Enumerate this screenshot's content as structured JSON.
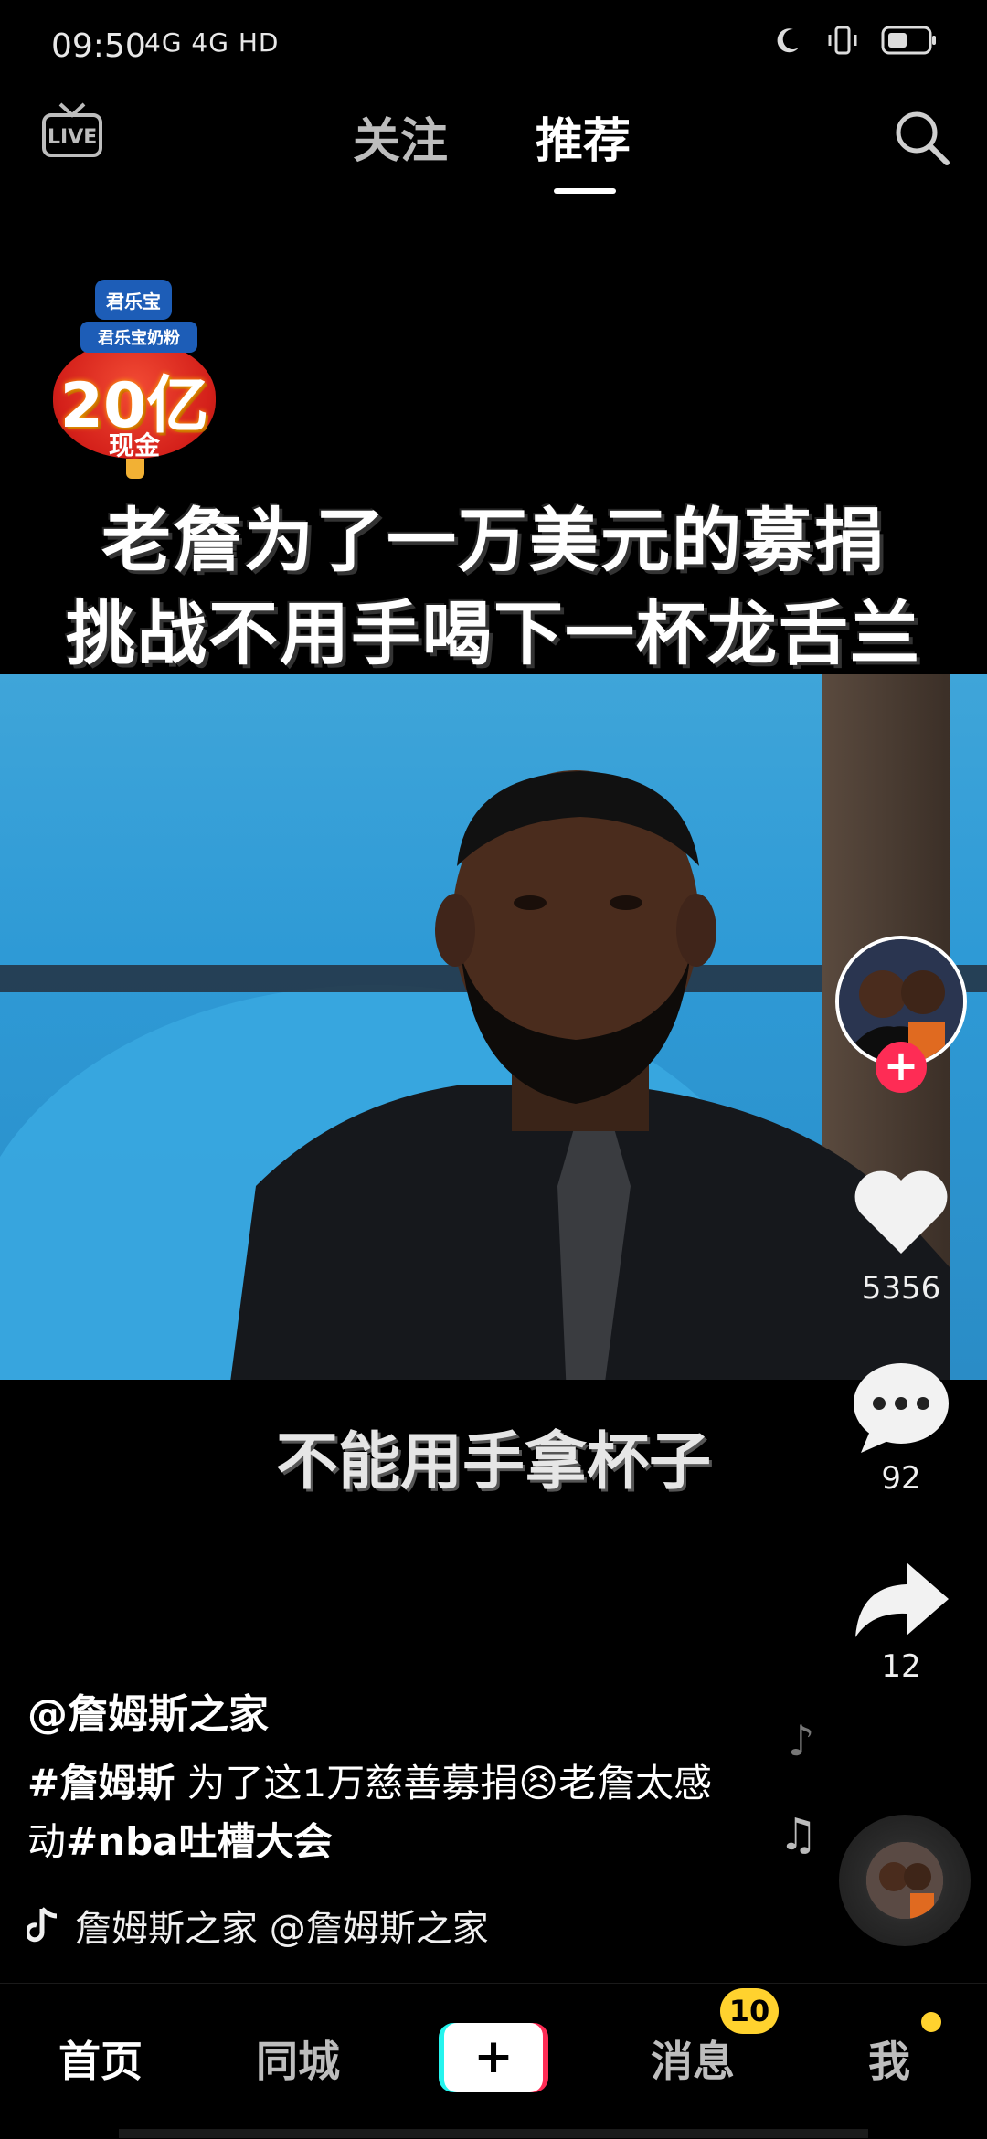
{
  "status_bar": {
    "time": "09:50",
    "network": "4G 4G HD",
    "icons": [
      "moon-icon",
      "vibrate-icon",
      "battery-icon"
    ]
  },
  "top_nav": {
    "live_label": "LIVE",
    "tabs": [
      {
        "label": "关注",
        "active": false
      },
      {
        "label": "推荐",
        "active": true
      }
    ]
  },
  "promo": {
    "brand": "君乐宝",
    "sub": "君乐宝奶粉",
    "amount": "20亿",
    "label": "现金"
  },
  "video": {
    "headline_line1": "老詹为了一万美元的募捐",
    "headline_line2": "挑战不用手喝下一杯龙舌兰",
    "subtitle": "不能用手拿杯子"
  },
  "actions": {
    "likes": "5356",
    "comments": "92",
    "shares": "12"
  },
  "post": {
    "author": "@詹姆斯之家",
    "hashtag_main": "#詹姆斯",
    "desc_text": " 为了这1万慈善募捐😣老詹太感动",
    "hashtag_tail": "#nba吐槽大会",
    "music": "詹姆斯之家    @詹姆斯之家"
  },
  "bottom_nav": {
    "home": "首页",
    "city": "同城",
    "plus": "+",
    "messages": "消息",
    "messages_badge": "10",
    "me": "我"
  },
  "colors": {
    "accent_red": "#fe2c55",
    "accent_cyan": "#25f4ee",
    "badge_yellow": "#ffd22e"
  }
}
